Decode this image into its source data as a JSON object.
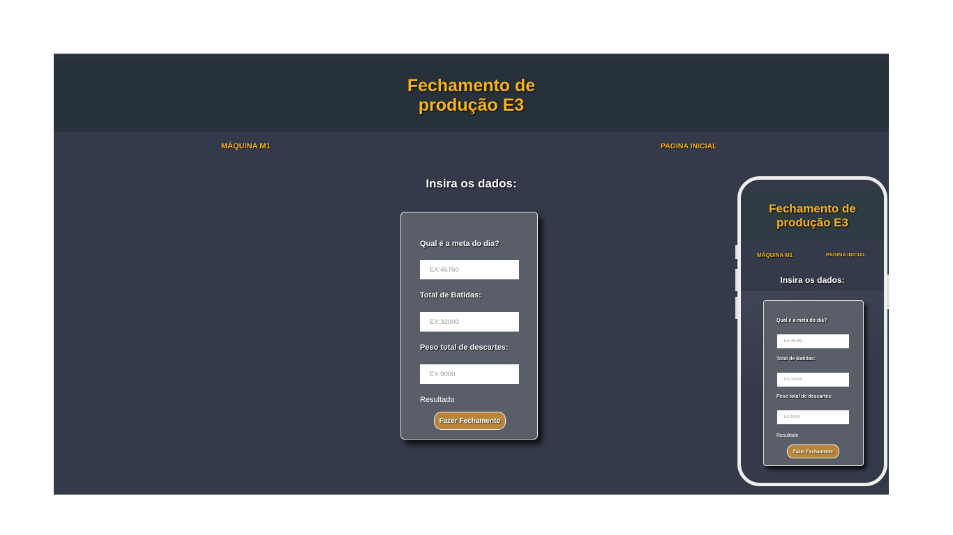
{
  "header": {
    "title": "Fechamento de produção E3"
  },
  "nav": {
    "machine": "MÁQUINA M1",
    "home": "PAGINA INICIAL"
  },
  "form": {
    "heading": "Insira os dados:",
    "fields": [
      {
        "label": "Qual é a meta do dia?",
        "placeholder": "EX:46760"
      },
      {
        "label": "Total de Batidas:",
        "placeholder": "EX:32000"
      },
      {
        "label": "Peso total de descartes:",
        "placeholder": "EX:9000"
      }
    ],
    "result_label": "Resultado",
    "submit_label": "Fazer Fechamento"
  },
  "colors": {
    "accent": "#f7b41b",
    "button": "#b88539",
    "background": "#343a4a",
    "header_bg": "#273139",
    "card_bg": "#5a5e69"
  }
}
